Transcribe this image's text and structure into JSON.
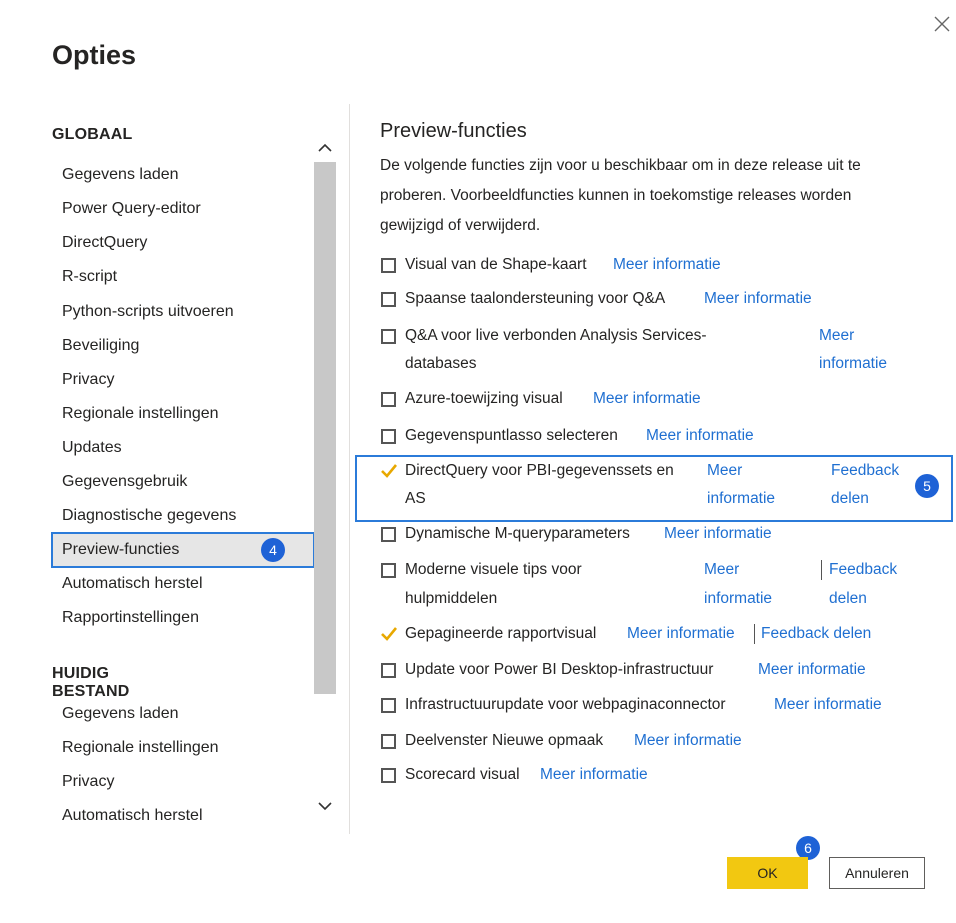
{
  "dialog": {
    "title": "Opties",
    "close_icon": "close-icon"
  },
  "nav": {
    "global_heading": "GLOBAAL",
    "global_items": [
      "Gegevens laden",
      "Power Query-editor",
      "DirectQuery",
      "R-script",
      "Python-scripts uitvoeren",
      "Beveiliging",
      "Privacy",
      "Regionale instellingen",
      "Updates",
      "Gegevensgebruik",
      "Diagnostische gegevens",
      "Preview-functies",
      "Automatisch herstel",
      "Rapportinstellingen"
    ],
    "selected_item": "Preview-functies",
    "file_heading": "HUIDIG BESTAND",
    "file_items": [
      "Gegevens laden",
      "Regionale instellingen",
      "Privacy",
      "Automatisch herstel"
    ]
  },
  "markers": {
    "m4": "4",
    "m5": "5",
    "m6": "6"
  },
  "content": {
    "title": "Preview-functies",
    "description": "De volgende functies zijn voor u beschikbaar om in deze release uit te proberen. Voorbeeldfuncties kunnen in toekomstige releases worden gewijzigd of verwijderd.",
    "features": [
      {
        "label": "Visual van de Shape-kaart",
        "checked": false,
        "link": "Meer informatie"
      },
      {
        "label": "Spaanse taalondersteuning voor Q&A",
        "checked": false,
        "link": "Meer informatie"
      },
      {
        "label_line1": "Q&A voor live verbonden Analysis Services-",
        "label_line2": "databases",
        "checked": false,
        "link_line1": "Meer",
        "link_line2": "informatie"
      },
      {
        "label": "Azure-toewijzing visual",
        "checked": false,
        "link": "Meer informatie"
      },
      {
        "label": "Gegevenspuntlasso selecteren",
        "checked": false,
        "link": "Meer informatie"
      },
      {
        "label_line1": "DirectQuery voor PBI-gegevenssets en",
        "label_line2": "AS",
        "checked": true,
        "link_line1": "Meer",
        "link_line2": "informatie",
        "feedback_line1": "Feedback",
        "feedback_line2": "delen"
      },
      {
        "label": "Dynamische M-queryparameters",
        "checked": false,
        "link": "Meer informatie"
      },
      {
        "label_line1": "Moderne visuele tips voor",
        "label_line2": "hulpmiddelen",
        "checked": false,
        "link_line1": "Meer",
        "link_line2": "informatie",
        "feedback_line1": "Feedback",
        "feedback_line2": "delen"
      },
      {
        "label": "Gepagineerde rapportvisual",
        "checked": true,
        "link": "Meer informatie",
        "feedback": "Feedback delen"
      },
      {
        "label": "Update voor Power BI Desktop-infrastructuur",
        "checked": false,
        "link": "Meer informatie"
      },
      {
        "label": "Infrastructuurupdate voor webpaginaconnector",
        "checked": false,
        "link": "Meer informatie"
      },
      {
        "label": "Deelvenster Nieuwe opmaak",
        "checked": false,
        "link": "Meer informatie"
      },
      {
        "label": "Scorecard visual",
        "checked": false,
        "link": "Meer informatie"
      }
    ]
  },
  "buttons": {
    "ok": "OK",
    "cancel": "Annuleren"
  },
  "colors": {
    "accent_yellow": "#f2c811",
    "link_blue": "#1f6fd1",
    "highlight_blue": "#2b7bd9",
    "marker_blue": "#1e62d6"
  }
}
